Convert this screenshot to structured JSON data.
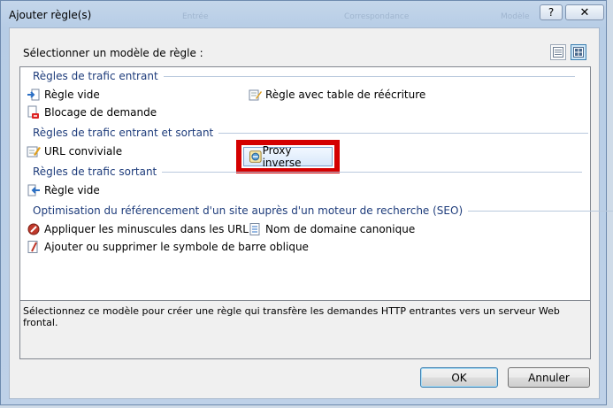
{
  "window": {
    "title": "Ajouter règle(s)",
    "help_label": "?",
    "close_label": "✕",
    "background_tabs": [
      "Entrée",
      "Correspondance",
      "Modèle"
    ]
  },
  "dialog": {
    "select_label": "Sélectionner un modèle de règle :",
    "view_buttons": [
      "list-view-icon",
      "tile-view-icon"
    ],
    "groups": [
      {
        "label": "Règles de trafic entrant",
        "items": [
          {
            "label": "Règle vide",
            "icon": "inbound-arrow-icon"
          },
          {
            "label": "Règle avec table de réécriture",
            "icon": "rewrite-map-icon"
          },
          {
            "label": "Blocage de demande",
            "icon": "block-request-icon"
          }
        ]
      },
      {
        "label": "Règles de trafic entrant et sortant",
        "items": [
          {
            "label": "URL conviviale",
            "icon": "friendly-url-icon"
          },
          {
            "label": "Proxy inverse",
            "icon": "reverse-proxy-icon",
            "selected": true
          }
        ]
      },
      {
        "label": "Règles de trafic sortant",
        "items": [
          {
            "label": "Règle vide",
            "icon": "outbound-arrow-icon"
          }
        ]
      },
      {
        "label": "Optimisation du référencement d'un site auprès d'un moteur de recherche (SEO)",
        "items": [
          {
            "label": "Appliquer les minuscules dans les URL",
            "icon": "lowercase-icon"
          },
          {
            "label": "Nom de domaine canonique",
            "icon": "canonical-domain-icon"
          },
          {
            "label": "Ajouter ou supprimer le symbole de barre oblique",
            "icon": "trailing-slash-icon"
          }
        ]
      }
    ],
    "description": "Sélectionnez ce modèle pour créer une règle qui transfère les demandes HTTP entrantes vers un serveur Web frontal.",
    "ok_label": "OK",
    "cancel_label": "Annuler",
    "highlight_color": "#d40000",
    "accent_color": "#1e3c7b"
  }
}
